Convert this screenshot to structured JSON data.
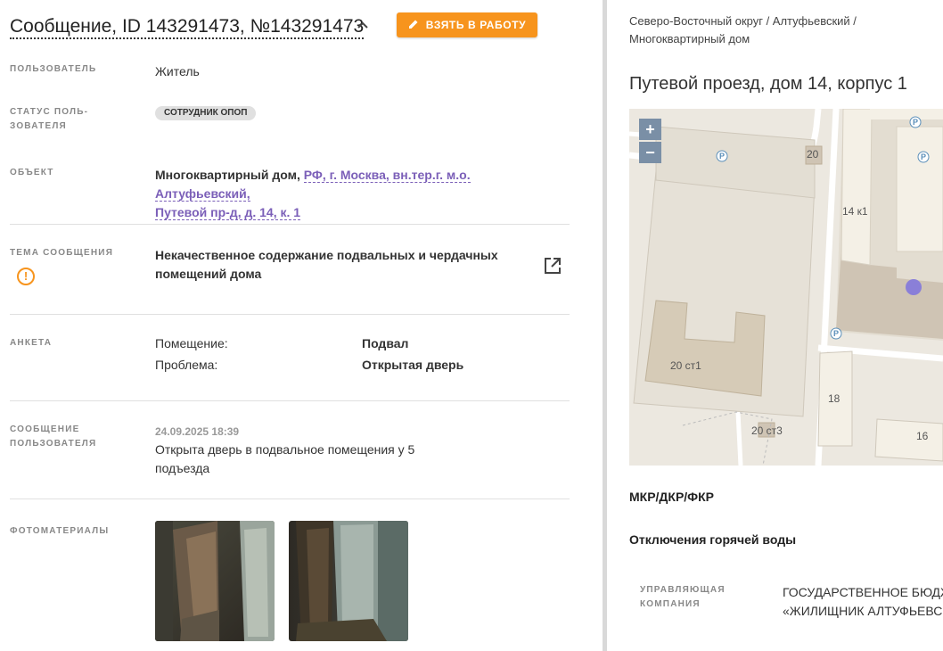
{
  "header": {
    "title": "Сообщение, ID 143291473, №143291473",
    "take_button_label": "ВЗЯТЬ В РАБОТУ"
  },
  "fields": {
    "user_label": "ПОЛЬЗОВАТЕЛЬ",
    "user_value": "Житель",
    "status_label_1": "СТАТУС ПОЛЬ-",
    "status_label_2": "ЗОВАТЕЛЯ",
    "status_value": "СОТРУДНИК ОПОП",
    "object_label": "ОБЪЕКТ",
    "object_type": "Многоквартирный дом,",
    "object_link_1": "РФ, г. Москва, вн.тер.г. м.о. Алтуфьевский,",
    "object_link_2": "Путевой пр-д, д. 14, к. 1",
    "topic_label": "ТЕМА СООБЩЕНИЯ",
    "topic_value_1": "Некачественное содержание подвальных и чердачных",
    "topic_value_2": "помещений дома",
    "survey_label": "АНКЕТА",
    "survey_rows": [
      {
        "key": "Помещение:",
        "value": "Подвал"
      },
      {
        "key": "Проблема:",
        "value": "Открытая дверь"
      }
    ],
    "message_label_1": "СООБЩЕНИЕ",
    "message_label_2": "ПОЛЬЗОВАТЕЛЯ",
    "message_date": "24.09.2025 18:39",
    "message_text_1": "Открыта дверь в подвальное помещения у 5",
    "message_text_2": "подъезда",
    "photos_label": "ФОТОМАТЕРИАЛЫ"
  },
  "right": {
    "breadcrumb_1": "Северо-Восточный округ / Алтуфьевский /",
    "breadcrumb_2": "Многоквартирный дом",
    "address": "Путевой проезд, дом 14, корпус 1",
    "map": {
      "zoom_in": "+",
      "zoom_out": "−",
      "labels": [
        "20",
        "14 к1",
        "20 ст1",
        "18",
        "20 ст3",
        "16"
      ],
      "parking": "P"
    },
    "section_1": "МКР/ДКР/ФКР",
    "section_2": "Отключения горячей воды",
    "mgmt_label_1": "УПРАВЛЯЮЩАЯ",
    "mgmt_label_2": "КОМПАНИЯ",
    "mgmt_value_1": "ГОСУДАРСТВЕННОЕ БЮДЖЕ",
    "mgmt_value_2": "«ЖИЛИЩНИК АЛТУФЬЕВСК"
  },
  "colors": {
    "accent": "#f7941d",
    "link": "#7b5fb8",
    "map_marker": "#8a7fd8"
  }
}
